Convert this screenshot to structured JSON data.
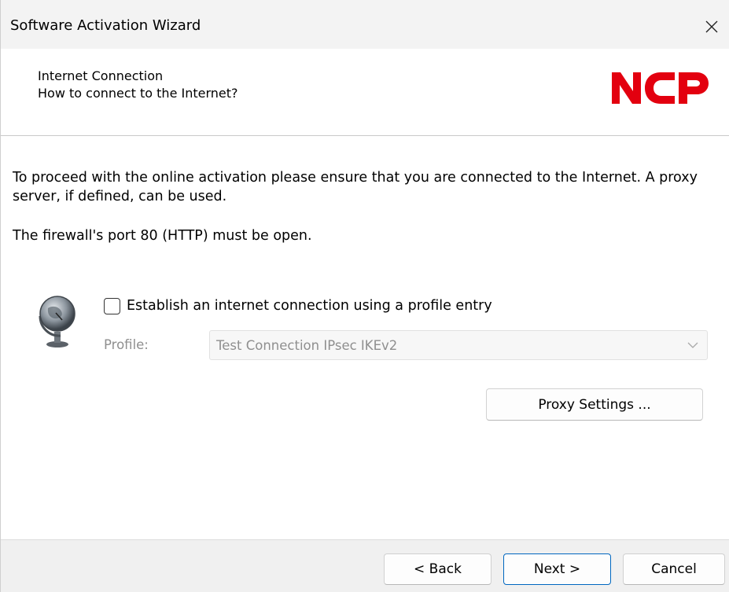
{
  "window": {
    "title": "Software Activation Wizard"
  },
  "header": {
    "title": "Internet Connection",
    "subtitle": "How to connect to the Internet?",
    "logo_text": "NCP",
    "logo_color": "#e3000f"
  },
  "content": {
    "intro": "To proceed with the online activation please ensure that you are connected to the Internet. A proxy server, if defined, can be used.",
    "port_note": "The firewall's port 80 (HTTP) must be open.",
    "globe_icon": "globe-icon",
    "checkbox_label": "Establish an internet connection using a profile entry",
    "checkbox_checked": false,
    "profile_label": "Profile:",
    "profile_value": "Test Connection IPsec IKEv2",
    "proxy_button": "Proxy Settings ..."
  },
  "footer": {
    "back": "< Back",
    "next": "Next >",
    "cancel": "Cancel"
  },
  "colors": {
    "accent": "#0067c0",
    "disabled_text": "#8f8f8f",
    "background": "#f0f0f0"
  }
}
